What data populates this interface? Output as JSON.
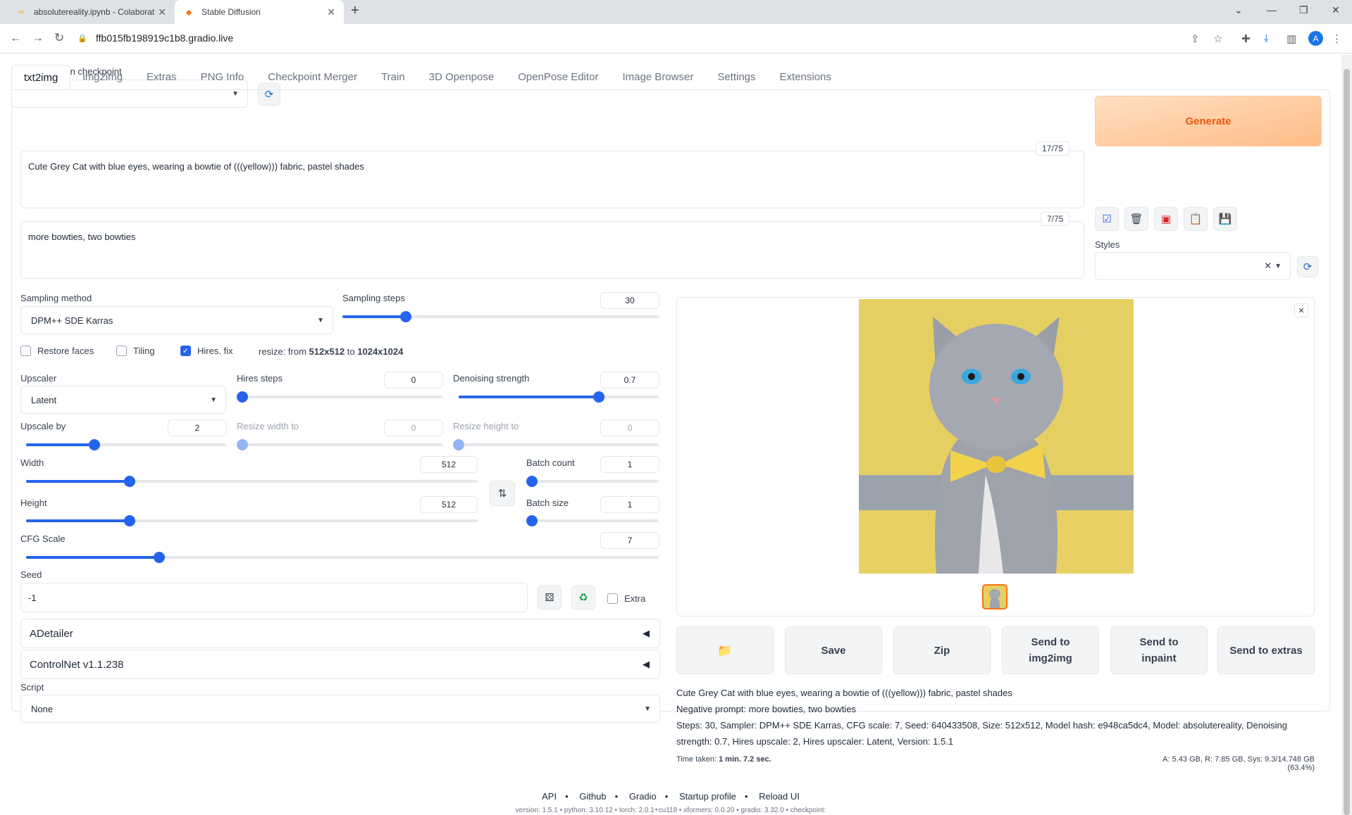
{
  "browser": {
    "tab_inactive": "absolutereality.ipynb - Colaborat",
    "tab_active": "Stable Diffusion",
    "url": "ffb015fb198919c1b8.gradio.live",
    "avatar_letter": "A"
  },
  "checkpoint": {
    "label": "Stable Diffusion checkpoint",
    "value": ""
  },
  "tabs": [
    "txt2img",
    "img2img",
    "Extras",
    "PNG Info",
    "Checkpoint Merger",
    "Train",
    "3D Openpose",
    "OpenPose Editor",
    "Image Browser",
    "Settings",
    "Extensions"
  ],
  "prompt": {
    "text": "Cute Grey Cat with blue eyes, wearing a bowtie of  (((yellow))) fabric, pastel shades",
    "counter": "17/75"
  },
  "negative": {
    "text": "more bowties, two bowties",
    "counter": "7/75"
  },
  "generate_label": "Generate",
  "styles": {
    "label": "Styles",
    "value": ""
  },
  "sampling": {
    "method_label": "Sampling method",
    "method": "DPM++ SDE Karras",
    "steps_label": "Sampling steps",
    "steps": "30",
    "steps_frac": 0.2
  },
  "checks": {
    "restore_faces": "Restore faces",
    "tiling": "Tiling",
    "hires": "Hires. fix",
    "resize_prefix": "resize: from",
    "resize_from": "512x512",
    "resize_to_word": "to",
    "resize_to": "1024x1024"
  },
  "upscaler": {
    "label": "Upscaler",
    "value": "Latent"
  },
  "hires_steps": {
    "label": "Hires steps",
    "value": "0",
    "frac": 0
  },
  "denoise": {
    "label": "Denoising strength",
    "value": "0.7",
    "frac": 0.7
  },
  "upscale_by": {
    "label": "Upscale by",
    "value": "2",
    "frac": 0.34
  },
  "resize_w": {
    "label": "Resize width to",
    "value": "0",
    "frac": 0
  },
  "resize_h": {
    "label": "Resize height to",
    "value": "0",
    "frac": 0
  },
  "width": {
    "label": "Width",
    "value": "512",
    "frac": 0.23
  },
  "height": {
    "label": "Height",
    "value": "512",
    "frac": 0.23
  },
  "batch_count": {
    "label": "Batch count",
    "value": "1",
    "frac": 0
  },
  "batch_size": {
    "label": "Batch size",
    "value": "1",
    "frac": 0
  },
  "cfg": {
    "label": "CFG Scale",
    "value": "7",
    "frac": 0.21
  },
  "seed": {
    "label": "Seed",
    "value": "-1",
    "extra": "Extra"
  },
  "accordions": [
    "ADetailer",
    "ControlNet v1.1.238"
  ],
  "script": {
    "label": "Script",
    "value": "None"
  },
  "output_buttons": [
    "📁",
    "Save",
    "Zip",
    "Send to img2img",
    "Send to inpaint",
    "Send to extras"
  ],
  "info": {
    "line1": "Cute Grey Cat with blue eyes, wearing a bowtie of (((yellow))) fabric, pastel shades",
    "line2": "Negative prompt: more bowties, two bowties",
    "line3": "Steps: 30, Sampler: DPM++ SDE Karras, CFG scale: 7, Seed: 640433508, Size: 512x512, Model hash: e948ca5dc4, Model: absolutereality, Denoising strength: 0.7, Hires upscale: 2, Hires upscaler: Latent, Version: 1.5.1",
    "time_label": "Time taken:",
    "time": "1 min. 7.2 sec.",
    "mem": "A: 5.43 GB, R: 7.85 GB, Sys: 9.3/14.748 GB (63.4%)"
  },
  "footer": {
    "links": [
      "API",
      "Github",
      "Gradio",
      "Startup profile",
      "Reload UI"
    ],
    "versions": "version: 1.5.1  •  python: 3.10.12  •  torch: 2.0.1+cu118  •  xformers: 0.0.20  •  gradio: 3.32.0  •  checkpoint:"
  }
}
